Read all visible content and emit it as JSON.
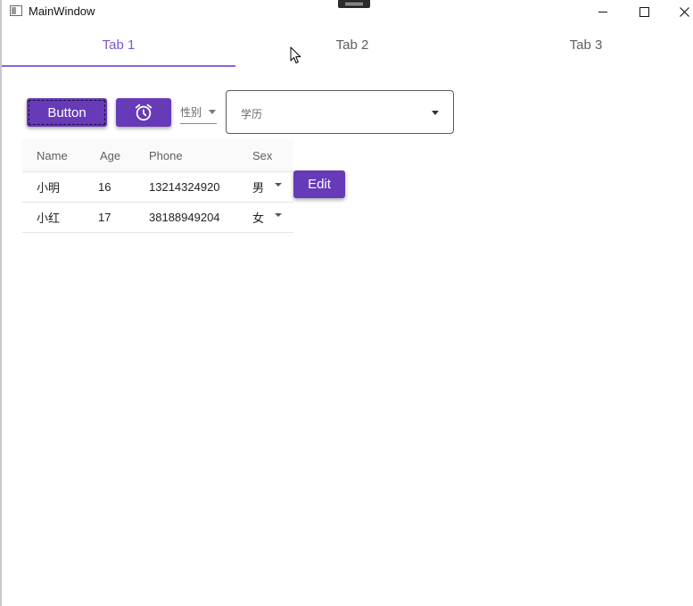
{
  "window": {
    "title": "MainWindow"
  },
  "tabs": [
    {
      "label": "Tab 1",
      "active": true
    },
    {
      "label": "Tab 2",
      "active": false
    },
    {
      "label": "Tab 3",
      "active": false
    }
  ],
  "toolbar": {
    "button_label": "Button",
    "alarm_icon": "alarm-clock-icon",
    "sex_combo_placeholder": "性别",
    "education_combo_placeholder": "学历"
  },
  "grid": {
    "columns": [
      "Name",
      "Age",
      "Phone",
      "Sex"
    ],
    "rows": [
      {
        "name": "小明",
        "age": "16",
        "phone": "13214324920",
        "sex": "男"
      },
      {
        "name": "小红",
        "age": "17",
        "phone": "38188949204",
        "sex": "女"
      }
    ]
  },
  "edit_button_label": "Edit",
  "colors": {
    "accent": "#673ab7",
    "tab_active": "#7e57c2"
  }
}
